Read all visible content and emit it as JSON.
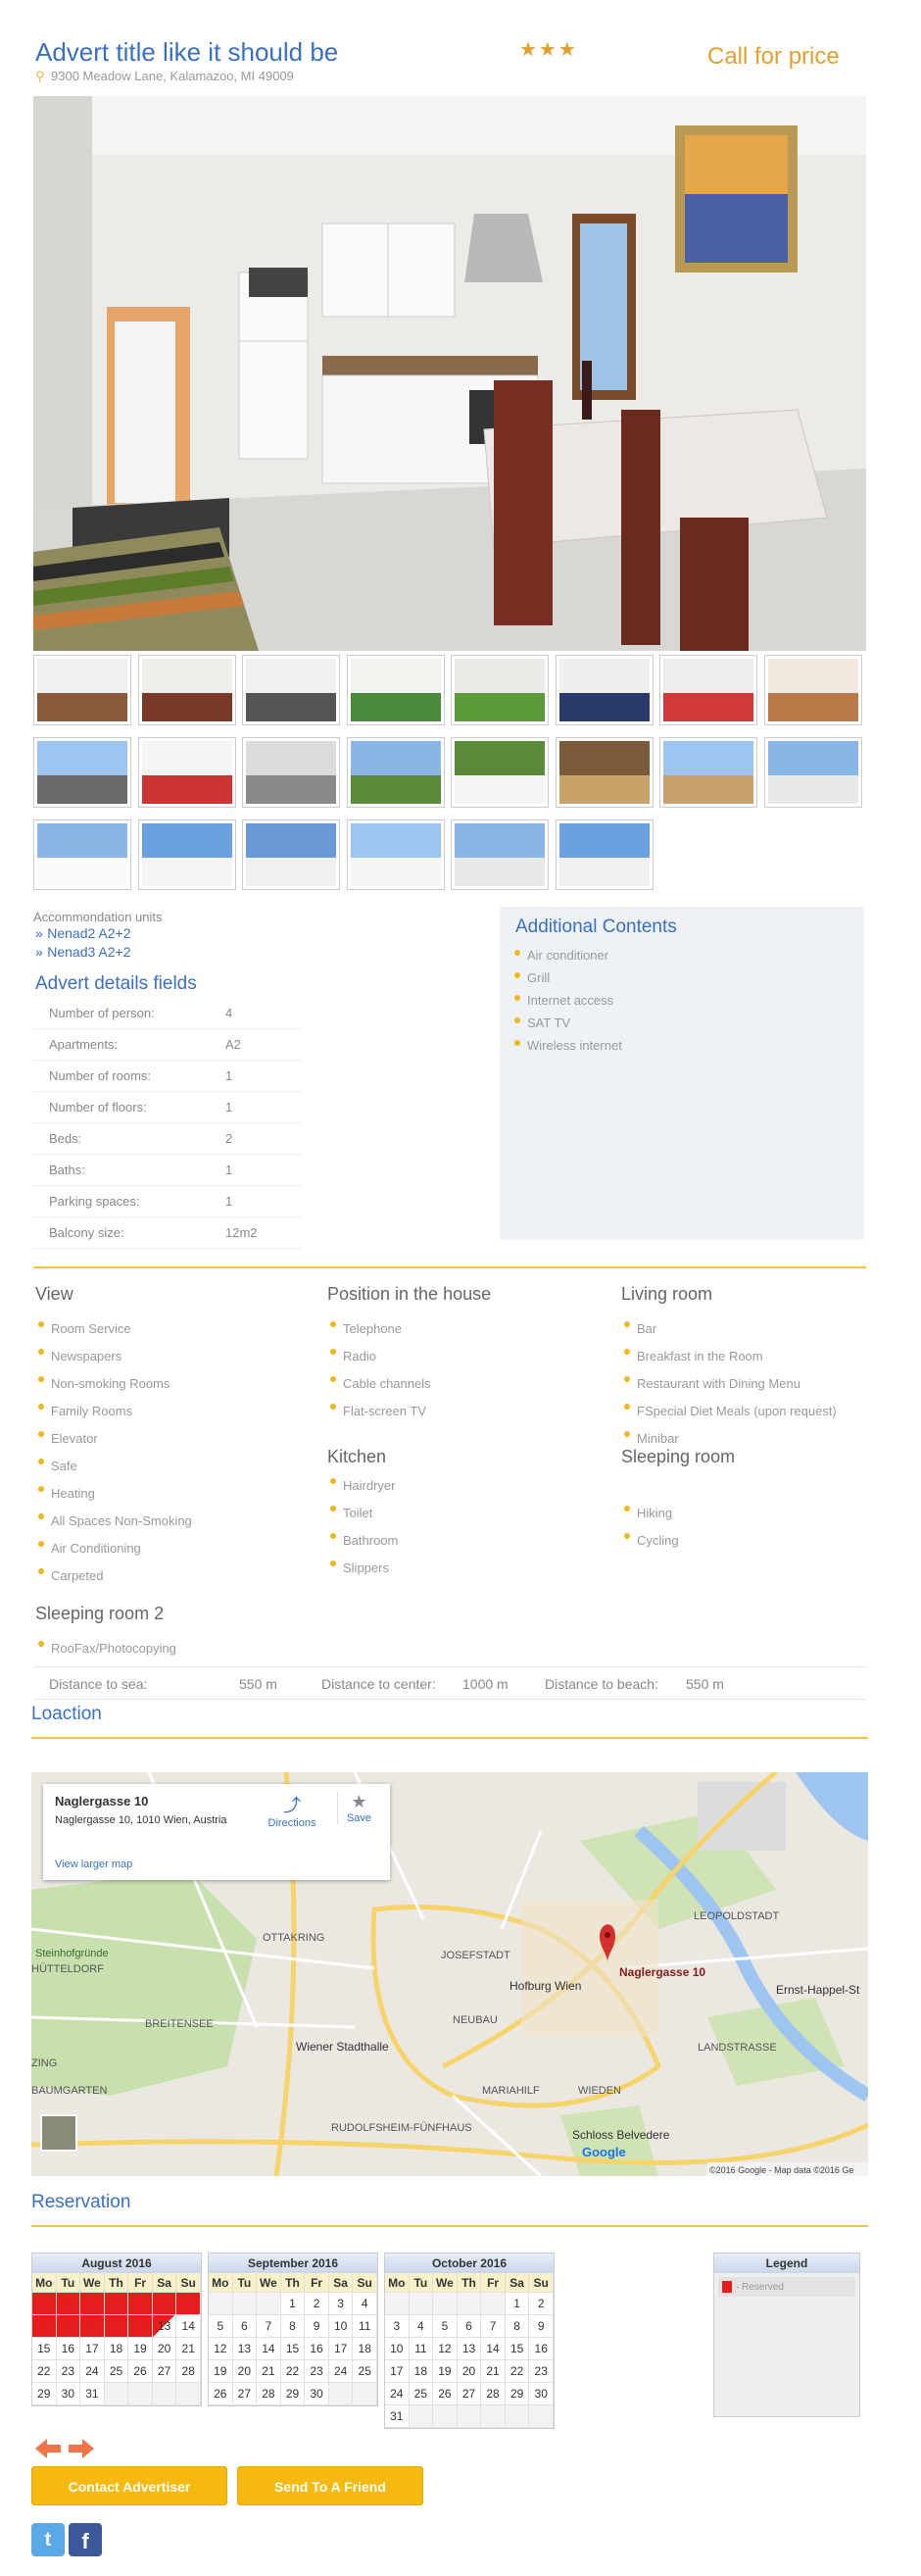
{
  "header": {
    "title": "Advert title like it should be",
    "address": "9300 Meadow Lane, Kalamazoo, MI 49009",
    "stars": "★★★",
    "price": "Call for price"
  },
  "units": {
    "label": "Accommondation units",
    "links": [
      "Nenad2 A2+2",
      "Nenad3 A2+2"
    ],
    "link_prefix": "»"
  },
  "details": {
    "heading": "Advert details fields",
    "rows": [
      {
        "k": "Number of person:",
        "v": "4"
      },
      {
        "k": "Apartments:",
        "v": "A2"
      },
      {
        "k": "Number of rooms:",
        "v": "1"
      },
      {
        "k": "Number of floors:",
        "v": "1"
      },
      {
        "k": "Beds:",
        "v": "2"
      },
      {
        "k": "Baths:",
        "v": "1"
      },
      {
        "k": "Parking spaces:",
        "v": "1"
      },
      {
        "k": "Balcony size:",
        "v": "12m2"
      }
    ]
  },
  "additional": {
    "heading": "Additional Contents",
    "items": [
      "Air conditioner",
      "Grill",
      "Internet access",
      "SAT TV",
      "Wireless internet"
    ]
  },
  "features": {
    "view": {
      "heading": "View",
      "items": [
        "Room Service",
        "Newspapers",
        "Non-smoking Rooms",
        "Family Rooms",
        "Elevator",
        "Safe",
        "Heating",
        "All Spaces Non-Smoking",
        "Air Conditioning",
        "Carpeted"
      ]
    },
    "position": {
      "heading": "Position in the house",
      "items": [
        "Telephone",
        "Radio",
        "Cable channels",
        "Flat-screen TV"
      ]
    },
    "kitchen": {
      "heading": "Kitchen",
      "items": [
        "Hairdryer",
        "Toilet",
        "Bathroom",
        "Slippers"
      ]
    },
    "living": {
      "heading": "Living room",
      "items": [
        "Bar",
        "Breakfast in the Room",
        "Restaurant with Dining Menu",
        "FSpecial Diet Meals (upon request)",
        "Minibar"
      ]
    },
    "sleeping": {
      "heading": "Sleeping room",
      "items": [
        "Hiking",
        "Cycling"
      ]
    },
    "sleeping2": {
      "heading": "Sleeping room 2",
      "items": [
        "RooFax/Photocopying"
      ]
    }
  },
  "distances": [
    {
      "k": "Distance to sea:",
      "v": "550 m"
    },
    {
      "k": "Distance to center:",
      "v": "1000 m"
    },
    {
      "k": "Distance to beach:",
      "v": "550 m"
    }
  ],
  "location": {
    "heading": "Loaction",
    "card_title": "Naglergasse 10",
    "card_address": "Naglergasse 10, 1010 Wien, Austria",
    "directions": "Directions",
    "save": "Save",
    "larger": "View larger map",
    "marker_label": "Naglergasse 10",
    "attribution": "©2016 Google - Map data ©2016 Ge",
    "google": "Google",
    "labels": [
      "OTTAKRING",
      "JOSEFSTADT",
      "LEOPOLDSTADT",
      "Steinhofgründe",
      "HÜTTELDORF",
      "BREITENSEE",
      "Hofburg Wien",
      "NEUBAU",
      "Wiener Stadthalle",
      "Ernst-Happel-St",
      "LANDSTRASSE",
      "MARIAHILF",
      "WIEDEN",
      "ZING",
      "BAUMGARTEN",
      "RUDOLFSHEIM-FÜNFHAUS",
      "Schloss Belvedere"
    ]
  },
  "reservation": {
    "heading": "Reservation",
    "weekdays": [
      "Mo",
      "Tu",
      "We",
      "Th",
      "Fr",
      "Sa",
      "Su"
    ],
    "months": [
      {
        "name": "August 2016",
        "offset": 0,
        "days": 31,
        "reserved": [
          1,
          2,
          3,
          4,
          5,
          6,
          7,
          8,
          9,
          10,
          11,
          12
        ],
        "half": [
          13
        ]
      },
      {
        "name": "September 2016",
        "offset": 3,
        "days": 30,
        "reserved": [],
        "half": []
      },
      {
        "name": "October 2016",
        "offset": 5,
        "days": 31,
        "reserved": [],
        "half": []
      }
    ],
    "legend_title": "Legend",
    "legend_reserved": "- Reserved",
    "reserved_color": "#e51d1d"
  },
  "actions": {
    "contact": "Contact Advertiser",
    "send": "Send To A Friend"
  },
  "social": {
    "twitter": "t",
    "facebook": "f"
  },
  "colors": {
    "accent": "#3a6fc1",
    "gold": "#f2b51b",
    "price": "#e0a030"
  }
}
